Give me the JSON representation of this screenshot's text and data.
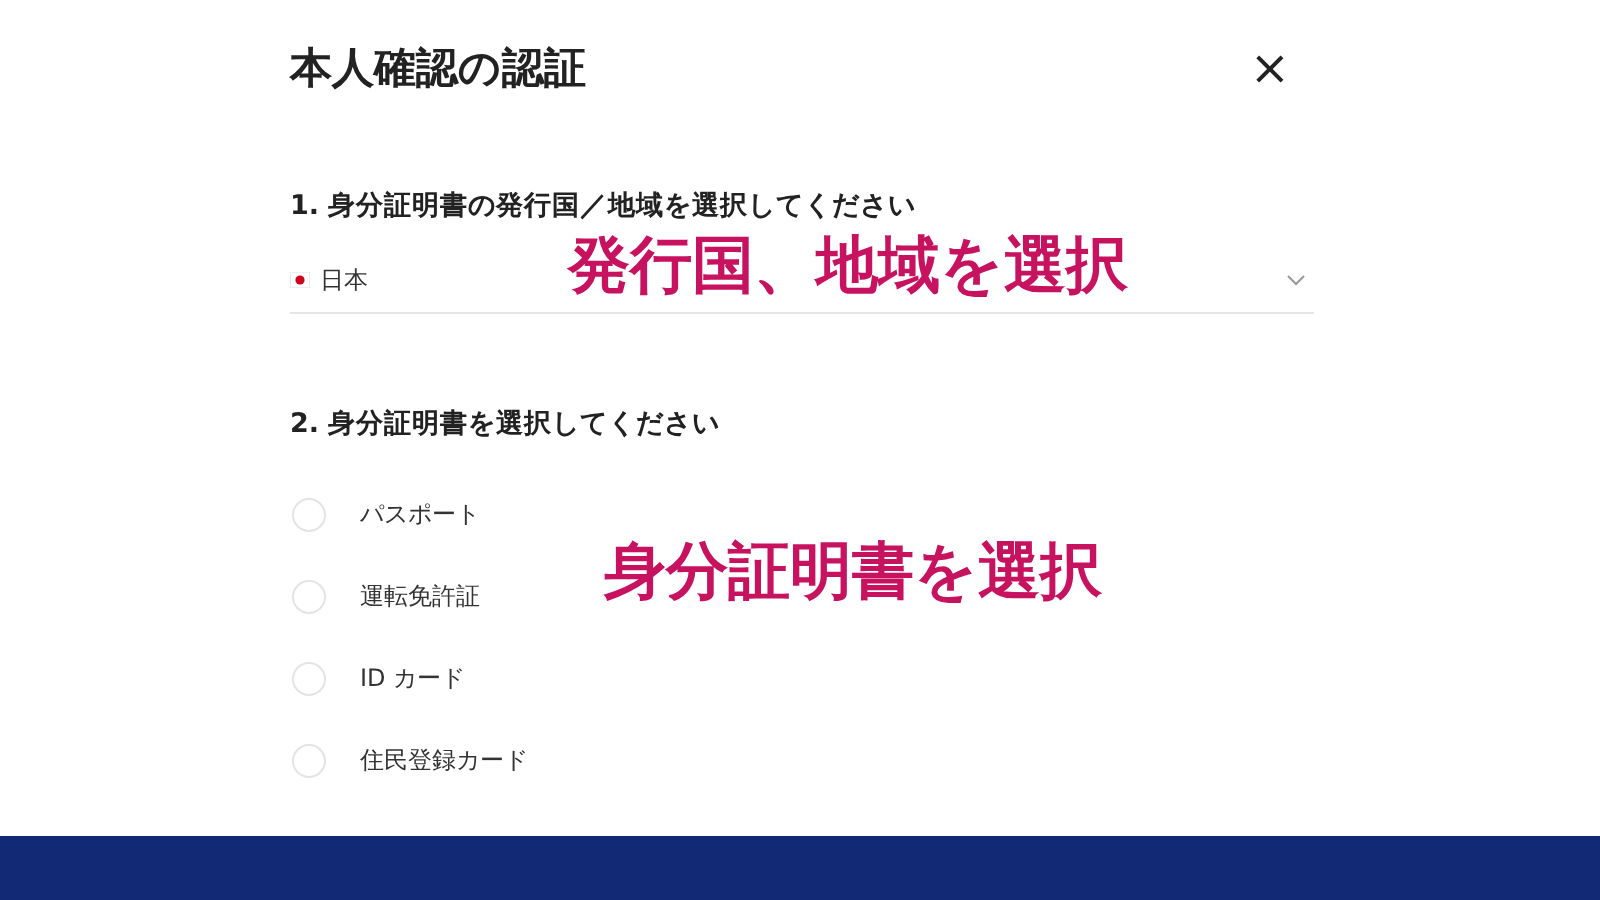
{
  "dialog": {
    "title": "本人確認の認証",
    "close": "×"
  },
  "country_step": {
    "label": "1. 身分証明書の発行国／地域を選択してください",
    "value": "日本"
  },
  "document_step": {
    "label": "2. 身分証明書を選択してください",
    "options": [
      {
        "label": "パスポート",
        "selected": false
      },
      {
        "label": "運転免許証",
        "selected": false
      },
      {
        "label": "ID カード",
        "selected": false
      },
      {
        "label": "住民登録カード",
        "selected": false
      }
    ]
  },
  "annotations": [
    "発行国、地域を選択",
    "身分証明書を選択"
  ]
}
